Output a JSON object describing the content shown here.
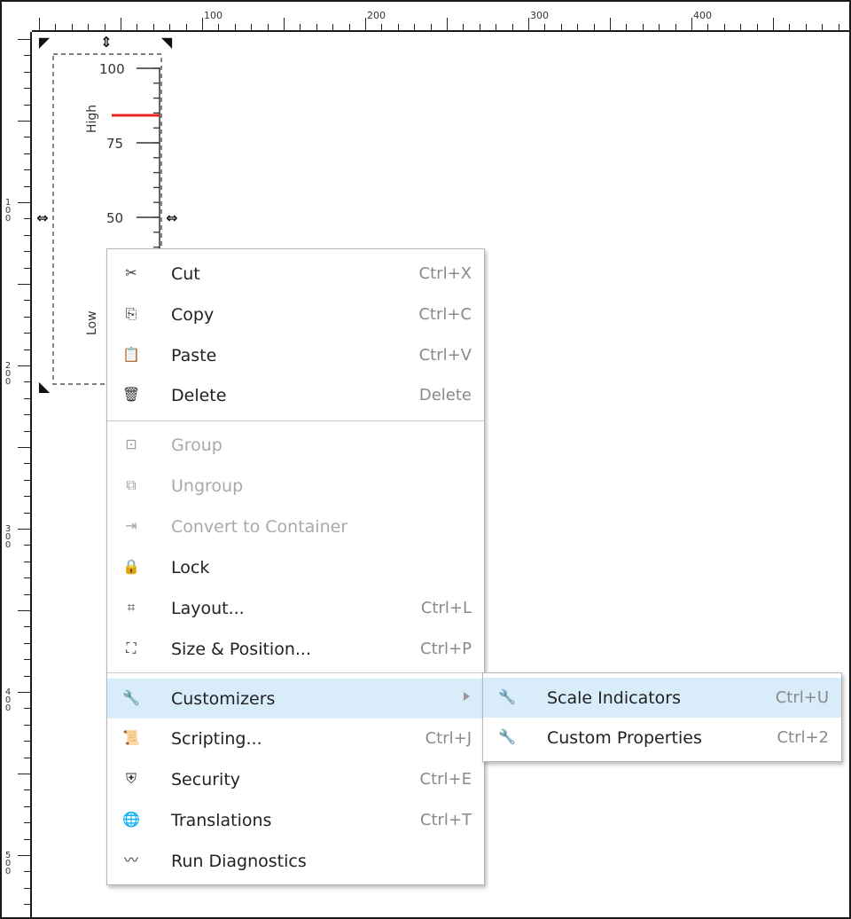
{
  "ruler": {
    "h_labels": [
      "100",
      "200",
      "300",
      "400"
    ],
    "v_labels": [
      "100",
      "200",
      "300",
      "400",
      "500"
    ]
  },
  "gauge": {
    "ticks": [
      "100",
      "75",
      "50"
    ],
    "high_label": "High",
    "low_label": "Low",
    "high_color": "#e8261f"
  },
  "context_menu": {
    "items": [
      {
        "label": "Cut",
        "shortcut": "Ctrl+X",
        "icon": "scissors-icon",
        "enabled": true
      },
      {
        "label": "Copy",
        "shortcut": "Ctrl+C",
        "icon": "copy-icon",
        "enabled": true
      },
      {
        "label": "Paste",
        "shortcut": "Ctrl+V",
        "icon": "clipboard-icon",
        "enabled": true
      },
      {
        "label": "Delete",
        "shortcut": "Delete",
        "icon": "trash-icon",
        "enabled": true
      },
      {
        "label": "Group",
        "shortcut": "",
        "icon": "group-icon",
        "enabled": false
      },
      {
        "label": "Ungroup",
        "shortcut": "",
        "icon": "ungroup-icon",
        "enabled": false
      },
      {
        "label": "Convert to Container",
        "shortcut": "",
        "icon": "container-icon",
        "enabled": false
      },
      {
        "label": "Lock",
        "shortcut": "",
        "icon": "lock-icon",
        "enabled": true
      },
      {
        "label": "Layout...",
        "shortcut": "Ctrl+L",
        "icon": "layout-icon",
        "enabled": true
      },
      {
        "label": "Size & Position...",
        "shortcut": "Ctrl+P",
        "icon": "size-position-icon",
        "enabled": true
      },
      {
        "label": "Customizers",
        "shortcut": "",
        "icon": "wrench-icon",
        "enabled": true,
        "submenu": true,
        "highlighted": true
      },
      {
        "label": "Scripting...",
        "shortcut": "Ctrl+J",
        "icon": "script-icon",
        "enabled": true
      },
      {
        "label": "Security",
        "shortcut": "Ctrl+E",
        "icon": "shield-icon",
        "enabled": true
      },
      {
        "label": "Translations",
        "shortcut": "Ctrl+T",
        "icon": "globe-icon",
        "enabled": true
      },
      {
        "label": "Run Diagnostics",
        "shortcut": "",
        "icon": "pulse-icon",
        "enabled": true
      }
    ]
  },
  "submenu": {
    "items": [
      {
        "label": "Scale Indicators",
        "shortcut": "Ctrl+U",
        "icon": "wrench-icon",
        "highlighted": true
      },
      {
        "label": "Custom Properties",
        "shortcut": "Ctrl+2",
        "icon": "wrench-icon",
        "highlighted": false
      }
    ]
  },
  "colors": {
    "menu_highlight": "#d9ecfa",
    "disabled_text": "#a9a9a9",
    "shortcut_text": "#8a8a8a"
  }
}
